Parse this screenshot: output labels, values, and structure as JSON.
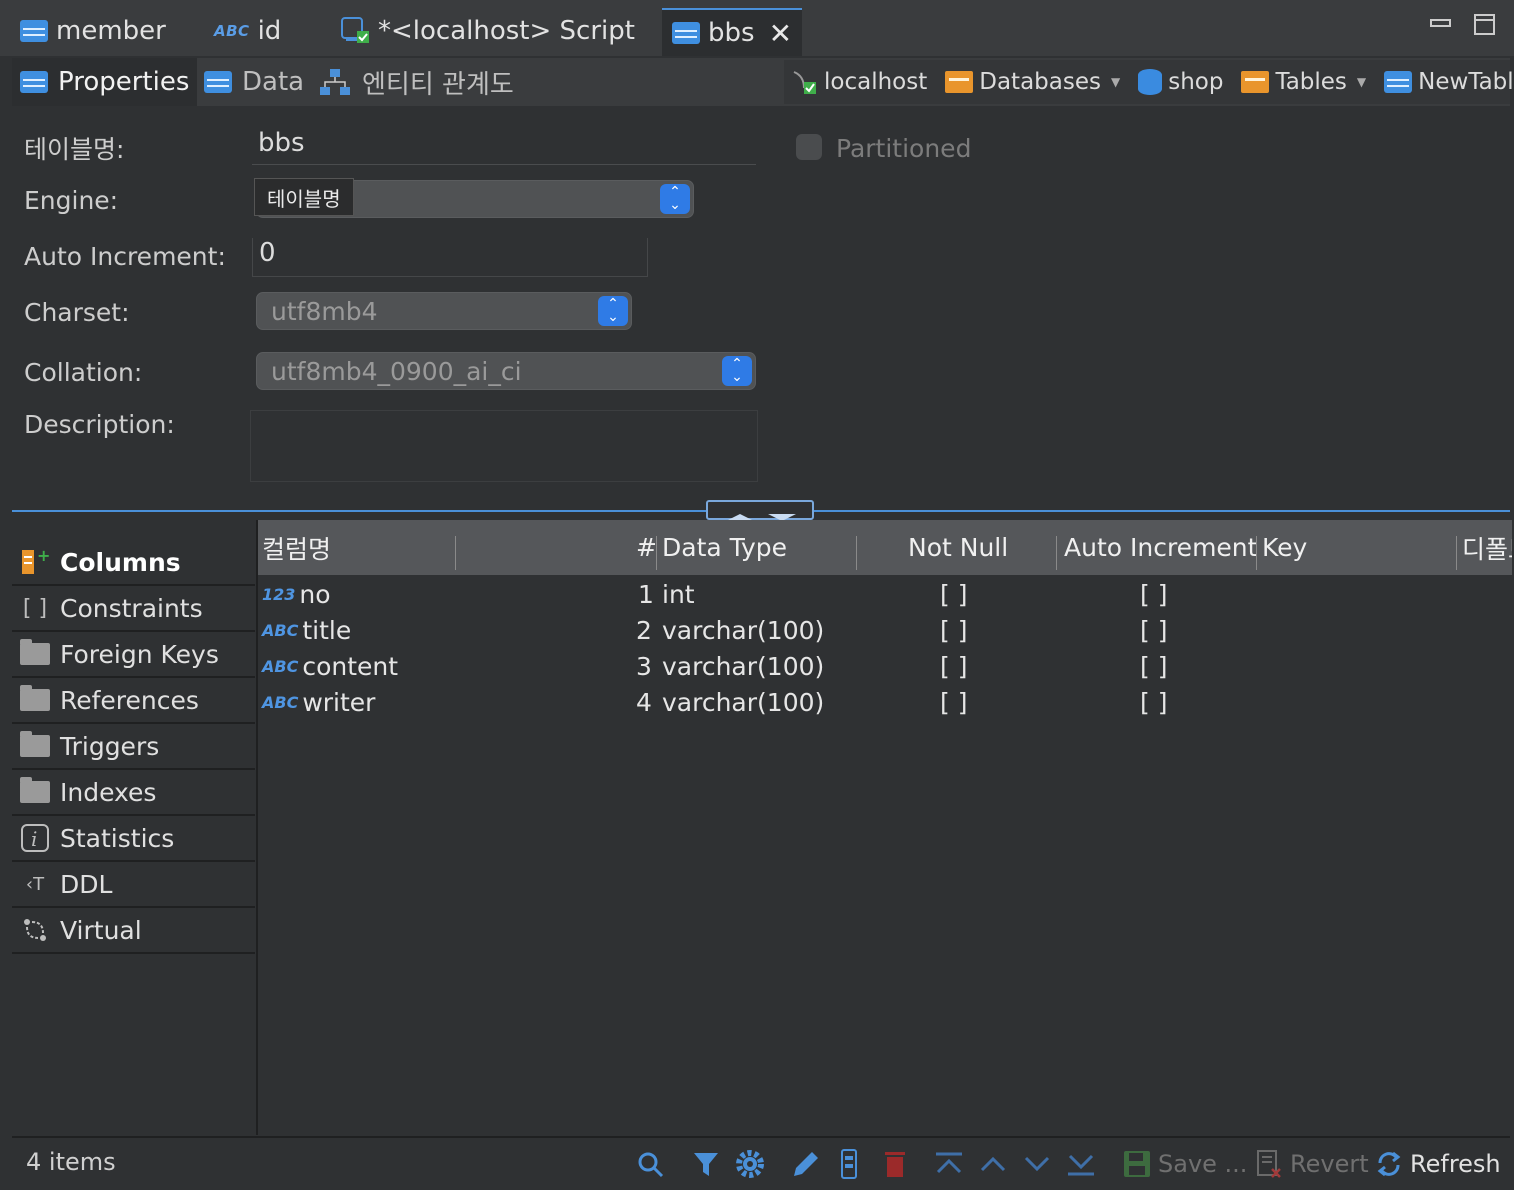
{
  "editor_tabs": [
    {
      "label": "member",
      "icon": "table-icon"
    },
    {
      "label": "id",
      "icon": "abc-icon"
    },
    {
      "label": "*<localhost> Script",
      "icon": "script-icon"
    },
    {
      "label": "bbs",
      "icon": "table-icon",
      "active": true
    }
  ],
  "sub_tabs": [
    {
      "label": "Properties",
      "active": true
    },
    {
      "label": "Data"
    },
    {
      "label": "엔티티 관계도"
    }
  ],
  "breadcrumb": {
    "connection": "localhost",
    "databases": "Databases",
    "schema": "shop",
    "tables": "Tables",
    "table": "NewTable"
  },
  "form": {
    "table_name_label": "테이블명:",
    "table_name_value": "bbs",
    "engine_label": "Engine:",
    "engine_value": "",
    "tooltip": "테이블명",
    "auto_increment_label": "Auto Increment:",
    "auto_increment_value": "0",
    "charset_label": "Charset:",
    "charset_value": "utf8mb4",
    "collation_label": "Collation:",
    "collation_value": "utf8mb4_0900_ai_ci",
    "description_label": "Description:",
    "description_value": "",
    "partitioned_label": "Partitioned"
  },
  "side_nav": [
    {
      "label": "Columns",
      "icon": "columns-icon",
      "active": true
    },
    {
      "label": "Constraints",
      "icon": "constraints-icon"
    },
    {
      "label": "Foreign Keys",
      "icon": "folder-icon"
    },
    {
      "label": "References",
      "icon": "folder-icon"
    },
    {
      "label": "Triggers",
      "icon": "folder-icon"
    },
    {
      "label": "Indexes",
      "icon": "folder-icon"
    },
    {
      "label": "Statistics",
      "icon": "info-icon"
    },
    {
      "label": "DDL",
      "icon": "ddl-icon"
    },
    {
      "label": "Virtual",
      "icon": "virtual-icon"
    }
  ],
  "grid": {
    "headers": {
      "name": "컬럼명",
      "num": "#",
      "type": "Data Type",
      "not_null": "Not Null",
      "auto_inc": "Auto Increment",
      "key": "Key",
      "default": "디폴트"
    },
    "rows": [
      {
        "type_icon": "123",
        "name": "no",
        "num": "1",
        "type": "int",
        "not_null": "[ ]",
        "auto_inc": "[ ]"
      },
      {
        "type_icon": "ABC",
        "name": "title",
        "num": "2",
        "type": "varchar(100)",
        "not_null": "[ ]",
        "auto_inc": "[ ]"
      },
      {
        "type_icon": "ABC",
        "name": "content",
        "num": "3",
        "type": "varchar(100)",
        "not_null": "[ ]",
        "auto_inc": "[ ]"
      },
      {
        "type_icon": "ABC",
        "name": "writer",
        "num": "4",
        "type": "varchar(100)",
        "not_null": "[ ]",
        "auto_inc": "[ ]"
      }
    ]
  },
  "status": {
    "count": "4 items",
    "save_label": "Save ...",
    "revert_label": "Revert",
    "refresh_label": "Refresh"
  },
  "colors": {
    "accent": "#4a90d9",
    "background": "#2f3133",
    "header": "#55575a"
  }
}
